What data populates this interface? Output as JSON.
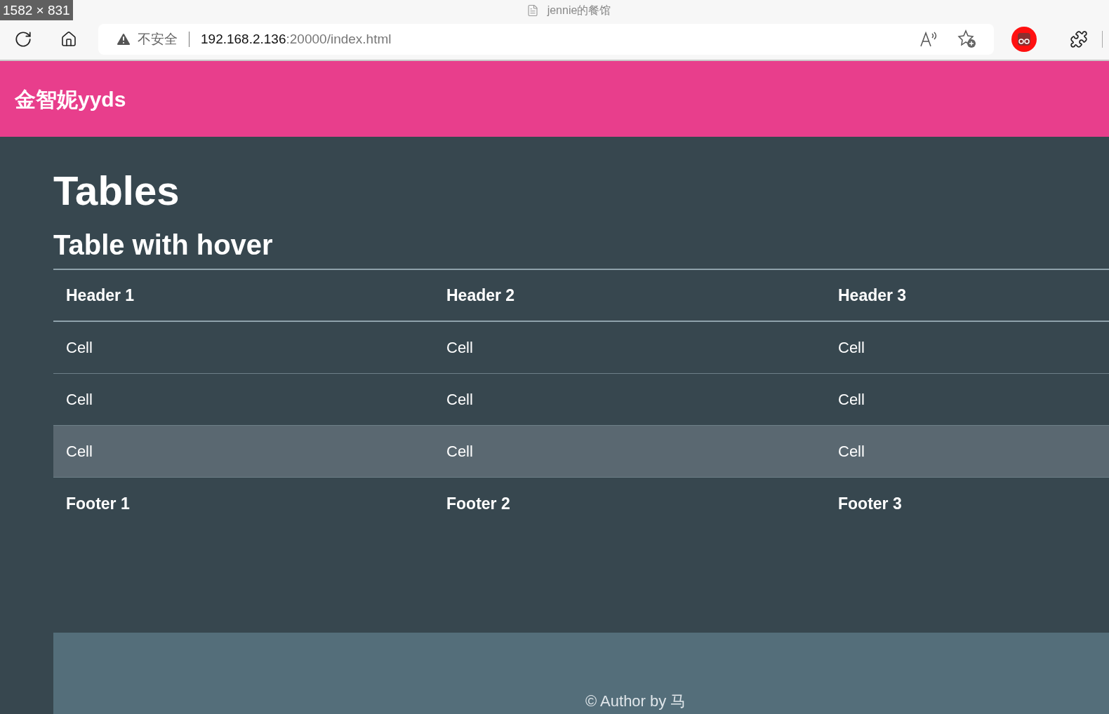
{
  "screenshot_size_label": "1582 × 831",
  "browser": {
    "tab_title": "jennie的餐馆",
    "security": "不安全",
    "url_host": "192.168.2.136",
    "url_rest": ":20000/index.html"
  },
  "navbar": {
    "brand": "金智妮yyds"
  },
  "page": {
    "title": "Tables",
    "subtitle": "Table with hover"
  },
  "table": {
    "columns": [
      "Header 1",
      "Header 2",
      "Header 3"
    ],
    "rows": [
      {
        "cells": [
          "Cell",
          "Cell",
          "Cell"
        ],
        "hovered": false
      },
      {
        "cells": [
          "Cell",
          "Cell",
          "Cell"
        ],
        "hovered": false
      },
      {
        "cells": [
          "Cell",
          "Cell",
          "Cell"
        ],
        "hovered": true
      }
    ],
    "footer": [
      "Footer 1",
      "Footer 2",
      "Footer 3"
    ]
  },
  "footer": {
    "text": "© Author by 马"
  }
}
